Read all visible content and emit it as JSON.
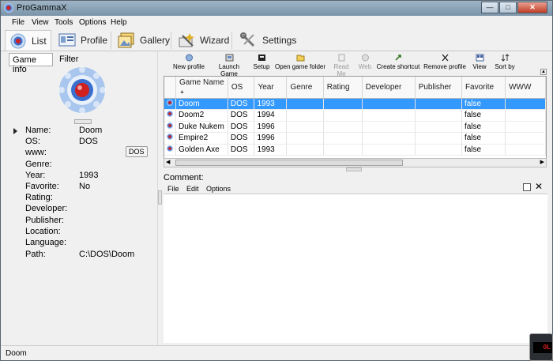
{
  "window": {
    "title": "ProGammaX"
  },
  "menu": [
    "File",
    "View",
    "Tools",
    "Options",
    "Help"
  ],
  "main_tabs": [
    {
      "label": "List",
      "icon": "list-icon"
    },
    {
      "label": "Profile",
      "icon": "profile-icon"
    },
    {
      "label": "Gallery",
      "icon": "gallery-icon"
    },
    {
      "label": "Wizard",
      "icon": "wizard-icon"
    },
    {
      "label": "Settings",
      "icon": "settings-icon"
    }
  ],
  "left_tabs": [
    "Game info",
    "Filter"
  ],
  "game_info": {
    "labels": [
      "Name:",
      "OS:",
      "www:",
      "Genre:",
      "Year:",
      "Favorite:",
      "Rating:",
      "Developer:",
      "Publisher:",
      "Location:",
      "Language:",
      "Path:"
    ],
    "values": {
      "name": "Doom",
      "os": "DOS",
      "year": "1993",
      "favorite": "No",
      "path": "C:\\DOS\\Doom"
    },
    "tooltip": "DOS"
  },
  "toolbar": [
    {
      "label": "New profile",
      "enabled": true
    },
    {
      "label": "Launch Game",
      "enabled": true
    },
    {
      "label": "Setup",
      "enabled": true
    },
    {
      "label": "Open game folder",
      "enabled": true
    },
    {
      "label": "Read Me",
      "enabled": false
    },
    {
      "label": "Web",
      "enabled": false
    },
    {
      "label": "Create shortcut",
      "enabled": true
    },
    {
      "label": "Remove profile",
      "enabled": true
    },
    {
      "label": "View",
      "enabled": true
    },
    {
      "label": "Sort by",
      "enabled": true
    }
  ],
  "grid": {
    "columns": [
      "Game Name",
      "OS",
      "Year",
      "Genre",
      "Rating",
      "Developer",
      "Publisher",
      "Favorite",
      "WWW"
    ],
    "rows": [
      {
        "name": "Doom",
        "os": "DOS",
        "year": "1993",
        "favorite": "false",
        "selected": true
      },
      {
        "name": "Doom2",
        "os": "DOS",
        "year": "1994",
        "favorite": "false"
      },
      {
        "name": "Duke Nukem",
        "os": "DOS",
        "year": "1996",
        "favorite": "false"
      },
      {
        "name": "Empire2",
        "os": "DOS",
        "year": "1996",
        "favorite": "false"
      },
      {
        "name": "Golden Axe",
        "os": "DOS",
        "year": "1993",
        "favorite": "false"
      }
    ]
  },
  "comment": {
    "label": "Comment:",
    "menu": [
      "File",
      "Edit",
      "Options"
    ]
  },
  "status": {
    "text": "Doom"
  },
  "colors": {
    "selection": "#3399ff",
    "accent_red": "#d02020",
    "accent_blue": "#3a6fd0"
  }
}
